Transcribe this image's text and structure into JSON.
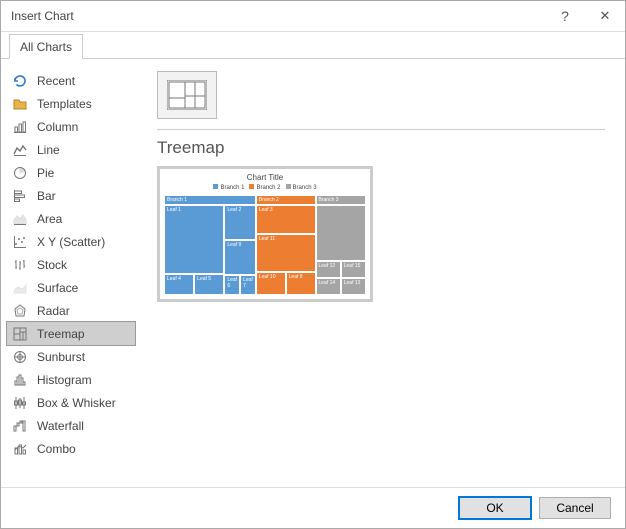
{
  "dialog": {
    "title": "Insert Chart",
    "tab_label": "All Charts"
  },
  "sidebar": {
    "items": [
      {
        "label": "Recent"
      },
      {
        "label": "Templates"
      },
      {
        "label": "Column"
      },
      {
        "label": "Line"
      },
      {
        "label": "Pie"
      },
      {
        "label": "Bar"
      },
      {
        "label": "Area"
      },
      {
        "label": "X Y (Scatter)"
      },
      {
        "label": "Stock"
      },
      {
        "label": "Surface"
      },
      {
        "label": "Radar"
      },
      {
        "label": "Treemap"
      },
      {
        "label": "Sunburst"
      },
      {
        "label": "Histogram"
      },
      {
        "label": "Box & Whisker"
      },
      {
        "label": "Waterfall"
      },
      {
        "label": "Combo"
      }
    ],
    "selected_index": 11
  },
  "content": {
    "heading": "Treemap",
    "preview_title": "Chart Title",
    "legend": [
      "Branch 1",
      "Branch 2",
      "Branch 3"
    ],
    "colors": {
      "branch1": "#5B9BD5",
      "branch2": "#ED7D31",
      "branch3": "#A5A5A5"
    }
  },
  "chart_data": {
    "type": "treemap",
    "title": "Chart Title",
    "series": [
      {
        "name": "Branch 1",
        "color": "#5B9BD5",
        "leaves": [
          {
            "name": "Leaf 1"
          },
          {
            "name": "Leaf 2"
          },
          {
            "name": "Leaf 4"
          },
          {
            "name": "Leaf 5"
          },
          {
            "name": "Leaf 6"
          },
          {
            "name": "Leaf 7"
          },
          {
            "name": "Leaf 9"
          }
        ]
      },
      {
        "name": "Branch 2",
        "color": "#ED7D31",
        "leaves": [
          {
            "name": "Leaf 3"
          },
          {
            "name": "Leaf 8"
          },
          {
            "name": "Leaf 10"
          },
          {
            "name": "Leaf 11"
          }
        ]
      },
      {
        "name": "Branch 3",
        "color": "#A5A5A5",
        "leaves": [
          {
            "name": "Leaf 12"
          },
          {
            "name": "Leaf 13"
          },
          {
            "name": "Leaf 14"
          },
          {
            "name": "Leaf 15"
          }
        ]
      }
    ]
  },
  "footer": {
    "ok": "OK",
    "cancel": "Cancel"
  }
}
